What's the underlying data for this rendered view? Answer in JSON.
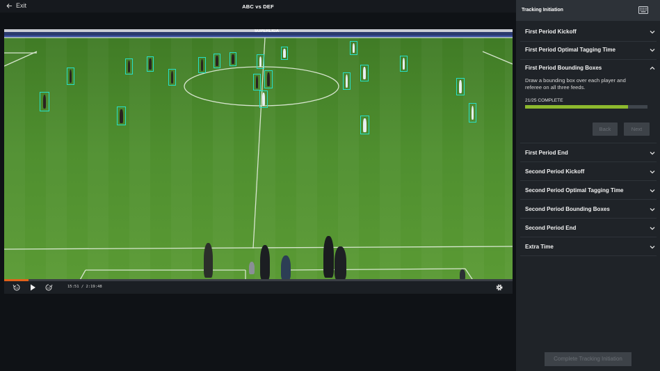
{
  "topbar": {
    "exit_label": "Exit",
    "match_title": "ABC vs DEF"
  },
  "player": {
    "time_display": "15:51 / 2:19:48",
    "progress_fraction": 0.0476,
    "icons": [
      "rewind-10-icon",
      "play-icon",
      "forward-10-icon",
      "gear-icon"
    ]
  },
  "field": {
    "ad_board_text": "SUPERLIGA"
  },
  "panel": {
    "title": "Tracking Initiation",
    "sections": [
      {
        "label": "First Period Kickoff",
        "expanded": false
      },
      {
        "label": "First Period Optimal Tagging Time",
        "expanded": false
      },
      {
        "label": "First Period Bounding Boxes",
        "expanded": true
      },
      {
        "label": "First Period End",
        "expanded": false
      },
      {
        "label": "Second Period Kickoff",
        "expanded": false
      },
      {
        "label": "Second Period Optimal Tagging Time",
        "expanded": false
      },
      {
        "label": "Second Period Bounding Boxes",
        "expanded": false
      },
      {
        "label": "Second Period End",
        "expanded": false
      },
      {
        "label": "Extra Time",
        "expanded": false
      }
    ],
    "active_section": {
      "description": "Draw a bounding box over each player and referee on all three feeds.",
      "progress_text": "21/25 COMPLETE",
      "progress_fraction": 0.84,
      "back_label": "Back",
      "next_label": "Next"
    },
    "complete_button_label": "Complete Tracking Initiation"
  },
  "colors": {
    "bbox": "#27e0c8",
    "progress_accent": "#e2621b",
    "complete_bar": "#8db92e",
    "panel_bg": "#1f2328"
  }
}
